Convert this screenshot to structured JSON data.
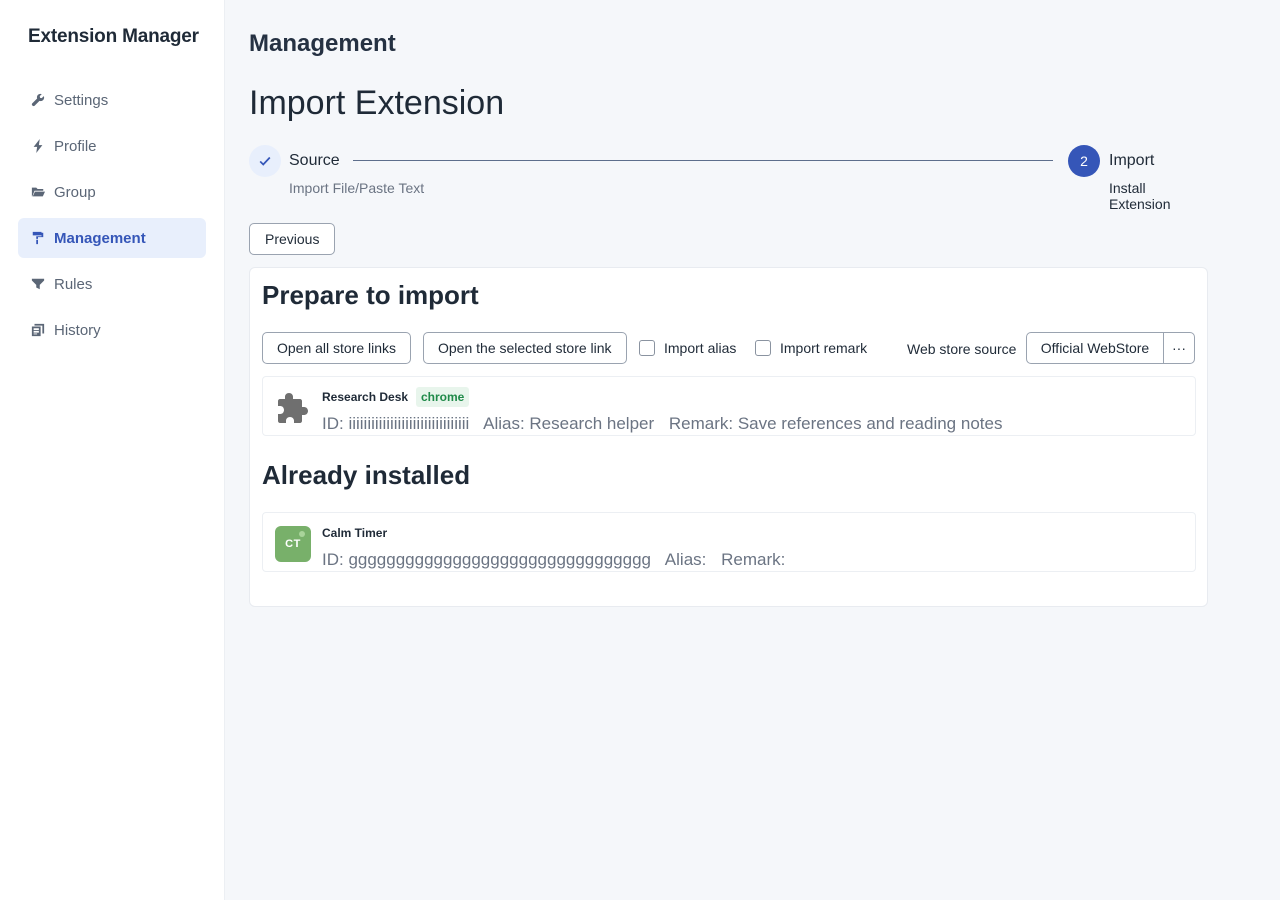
{
  "app": {
    "title": "Extension Manager"
  },
  "sidebar": {
    "items": [
      {
        "label": "Settings",
        "icon": "wrench-icon",
        "active": false
      },
      {
        "label": "Profile",
        "icon": "bolt-icon",
        "active": false
      },
      {
        "label": "Group",
        "icon": "folder-open-icon",
        "active": false
      },
      {
        "label": "Management",
        "icon": "paint-roller-icon",
        "active": true
      },
      {
        "label": "Rules",
        "icon": "filter-icon",
        "active": false
      },
      {
        "label": "History",
        "icon": "history-icon",
        "active": false
      }
    ]
  },
  "main": {
    "section_title": "Management",
    "page_title": "Import Extension",
    "steps": [
      {
        "number": "1",
        "title": "Source",
        "subtitle": "Import File/Paste Text",
        "status": "done"
      },
      {
        "number": "2",
        "title": "Import",
        "subtitle": "Install Extension",
        "status": "current"
      }
    ],
    "previous_label": "Previous",
    "prepare": {
      "heading": "Prepare to import",
      "open_all_label": "Open all store links",
      "open_selected_label": "Open the selected store link",
      "import_alias_label": "Import alias",
      "import_remark_label": "Import remark",
      "web_store_label": "Web store source",
      "web_store_value": "Official WebStore",
      "more_label": "···",
      "items": [
        {
          "name": "Research Desk",
          "tag": "chrome",
          "id_text": "ID: iiiiiiiiiiiiiiiiiiiiiiiiiiiiiiii",
          "alias_text": "Alias: Research helper",
          "remark_text": "Remark: Save references and reading notes"
        }
      ]
    },
    "installed": {
      "heading": "Already installed",
      "items": [
        {
          "name": "Calm Timer",
          "avatar_initials": "CT",
          "id_text": "ID: gggggggggggggggggggggggggggggggg",
          "alias_text": "Alias:",
          "remark_text": "Remark:"
        }
      ]
    }
  },
  "colors": {
    "accent": "#3556b8",
    "accent_light": "#e8effc",
    "tag_green": "#1f8a49",
    "avatar_green": "#78b06a"
  }
}
